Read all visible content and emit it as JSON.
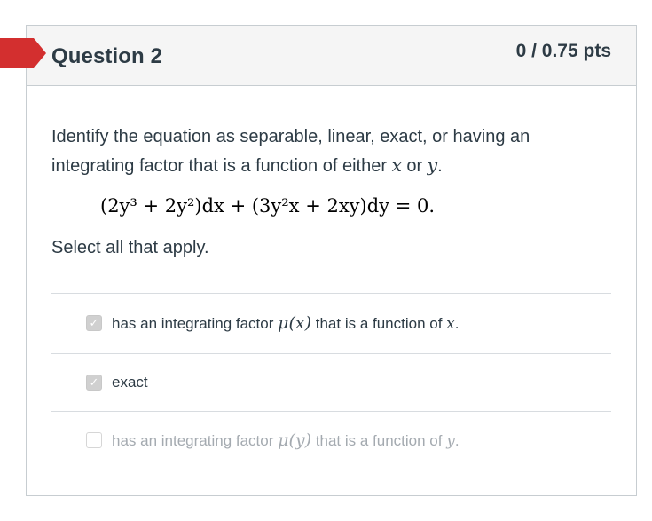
{
  "question": {
    "title": "Question 2",
    "points": "0 / 0.75 pts",
    "prompt_line1": "Identify the equation as separable, linear, exact, or having an",
    "prompt_line2_pre": "integrating factor that is a function of either ",
    "prompt_var_x": "x",
    "prompt_or": " or ",
    "prompt_var_y": "y",
    "prompt_end": ".",
    "equation": "(2y³ + 2y²)dx + (3y²x + 2xy)dy = 0.",
    "instruction": "Select all that apply."
  },
  "options": [
    {
      "text_pre": "has an integrating factor ",
      "math": "μ(x)",
      "text_post": " that is a function of ",
      "var": "x",
      "end": ".",
      "checked": true
    },
    {
      "text": "exact",
      "checked": true
    },
    {
      "text_pre": "has an integrating factor ",
      "math": "μ(y)",
      "text_post": " that is a function of ",
      "var": "y",
      "end": ".",
      "checked": false
    }
  ],
  "colors": {
    "flag": "#d32f2f",
    "text": "#2d3b45",
    "dim_text": "#a4aab0",
    "header_bg": "#f5f5f5",
    "border": "#c7cdd1"
  },
  "icons": {
    "flag": "question-flag-icon",
    "check": "checkmark-icon"
  }
}
